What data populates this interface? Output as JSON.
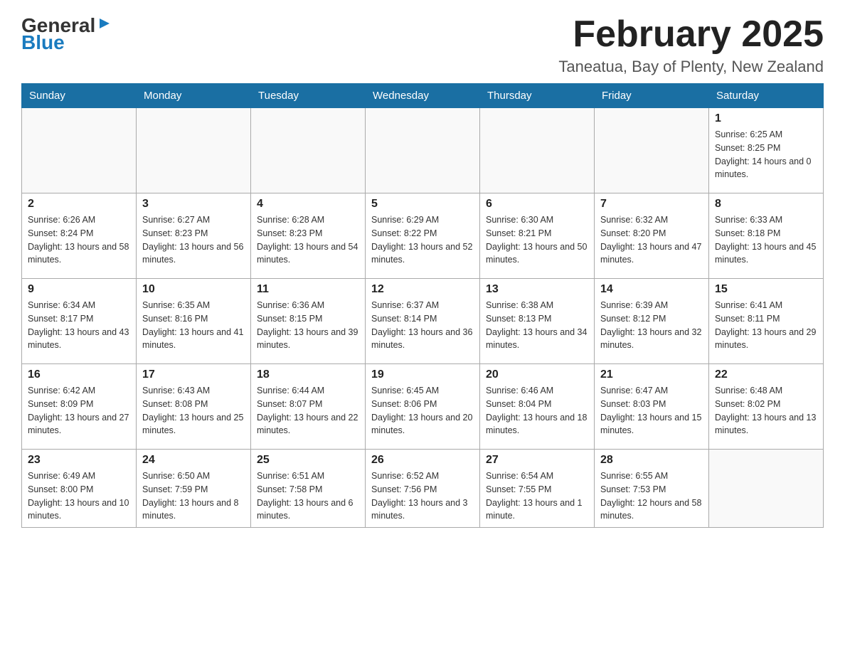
{
  "logo": {
    "general": "General",
    "blue": "Blue"
  },
  "title": "February 2025",
  "subtitle": "Taneatua, Bay of Plenty, New Zealand",
  "weekdays": [
    "Sunday",
    "Monday",
    "Tuesday",
    "Wednesday",
    "Thursday",
    "Friday",
    "Saturday"
  ],
  "weeks": [
    [
      {
        "day": "",
        "info": ""
      },
      {
        "day": "",
        "info": ""
      },
      {
        "day": "",
        "info": ""
      },
      {
        "day": "",
        "info": ""
      },
      {
        "day": "",
        "info": ""
      },
      {
        "day": "",
        "info": ""
      },
      {
        "day": "1",
        "info": "Sunrise: 6:25 AM\nSunset: 8:25 PM\nDaylight: 14 hours and 0 minutes."
      }
    ],
    [
      {
        "day": "2",
        "info": "Sunrise: 6:26 AM\nSunset: 8:24 PM\nDaylight: 13 hours and 58 minutes."
      },
      {
        "day": "3",
        "info": "Sunrise: 6:27 AM\nSunset: 8:23 PM\nDaylight: 13 hours and 56 minutes."
      },
      {
        "day": "4",
        "info": "Sunrise: 6:28 AM\nSunset: 8:23 PM\nDaylight: 13 hours and 54 minutes."
      },
      {
        "day": "5",
        "info": "Sunrise: 6:29 AM\nSunset: 8:22 PM\nDaylight: 13 hours and 52 minutes."
      },
      {
        "day": "6",
        "info": "Sunrise: 6:30 AM\nSunset: 8:21 PM\nDaylight: 13 hours and 50 minutes."
      },
      {
        "day": "7",
        "info": "Sunrise: 6:32 AM\nSunset: 8:20 PM\nDaylight: 13 hours and 47 minutes."
      },
      {
        "day": "8",
        "info": "Sunrise: 6:33 AM\nSunset: 8:18 PM\nDaylight: 13 hours and 45 minutes."
      }
    ],
    [
      {
        "day": "9",
        "info": "Sunrise: 6:34 AM\nSunset: 8:17 PM\nDaylight: 13 hours and 43 minutes."
      },
      {
        "day": "10",
        "info": "Sunrise: 6:35 AM\nSunset: 8:16 PM\nDaylight: 13 hours and 41 minutes."
      },
      {
        "day": "11",
        "info": "Sunrise: 6:36 AM\nSunset: 8:15 PM\nDaylight: 13 hours and 39 minutes."
      },
      {
        "day": "12",
        "info": "Sunrise: 6:37 AM\nSunset: 8:14 PM\nDaylight: 13 hours and 36 minutes."
      },
      {
        "day": "13",
        "info": "Sunrise: 6:38 AM\nSunset: 8:13 PM\nDaylight: 13 hours and 34 minutes."
      },
      {
        "day": "14",
        "info": "Sunrise: 6:39 AM\nSunset: 8:12 PM\nDaylight: 13 hours and 32 minutes."
      },
      {
        "day": "15",
        "info": "Sunrise: 6:41 AM\nSunset: 8:11 PM\nDaylight: 13 hours and 29 minutes."
      }
    ],
    [
      {
        "day": "16",
        "info": "Sunrise: 6:42 AM\nSunset: 8:09 PM\nDaylight: 13 hours and 27 minutes."
      },
      {
        "day": "17",
        "info": "Sunrise: 6:43 AM\nSunset: 8:08 PM\nDaylight: 13 hours and 25 minutes."
      },
      {
        "day": "18",
        "info": "Sunrise: 6:44 AM\nSunset: 8:07 PM\nDaylight: 13 hours and 22 minutes."
      },
      {
        "day": "19",
        "info": "Sunrise: 6:45 AM\nSunset: 8:06 PM\nDaylight: 13 hours and 20 minutes."
      },
      {
        "day": "20",
        "info": "Sunrise: 6:46 AM\nSunset: 8:04 PM\nDaylight: 13 hours and 18 minutes."
      },
      {
        "day": "21",
        "info": "Sunrise: 6:47 AM\nSunset: 8:03 PM\nDaylight: 13 hours and 15 minutes."
      },
      {
        "day": "22",
        "info": "Sunrise: 6:48 AM\nSunset: 8:02 PM\nDaylight: 13 hours and 13 minutes."
      }
    ],
    [
      {
        "day": "23",
        "info": "Sunrise: 6:49 AM\nSunset: 8:00 PM\nDaylight: 13 hours and 10 minutes."
      },
      {
        "day": "24",
        "info": "Sunrise: 6:50 AM\nSunset: 7:59 PM\nDaylight: 13 hours and 8 minutes."
      },
      {
        "day": "25",
        "info": "Sunrise: 6:51 AM\nSunset: 7:58 PM\nDaylight: 13 hours and 6 minutes."
      },
      {
        "day": "26",
        "info": "Sunrise: 6:52 AM\nSunset: 7:56 PM\nDaylight: 13 hours and 3 minutes."
      },
      {
        "day": "27",
        "info": "Sunrise: 6:54 AM\nSunset: 7:55 PM\nDaylight: 13 hours and 1 minute."
      },
      {
        "day": "28",
        "info": "Sunrise: 6:55 AM\nSunset: 7:53 PM\nDaylight: 12 hours and 58 minutes."
      },
      {
        "day": "",
        "info": ""
      }
    ]
  ]
}
